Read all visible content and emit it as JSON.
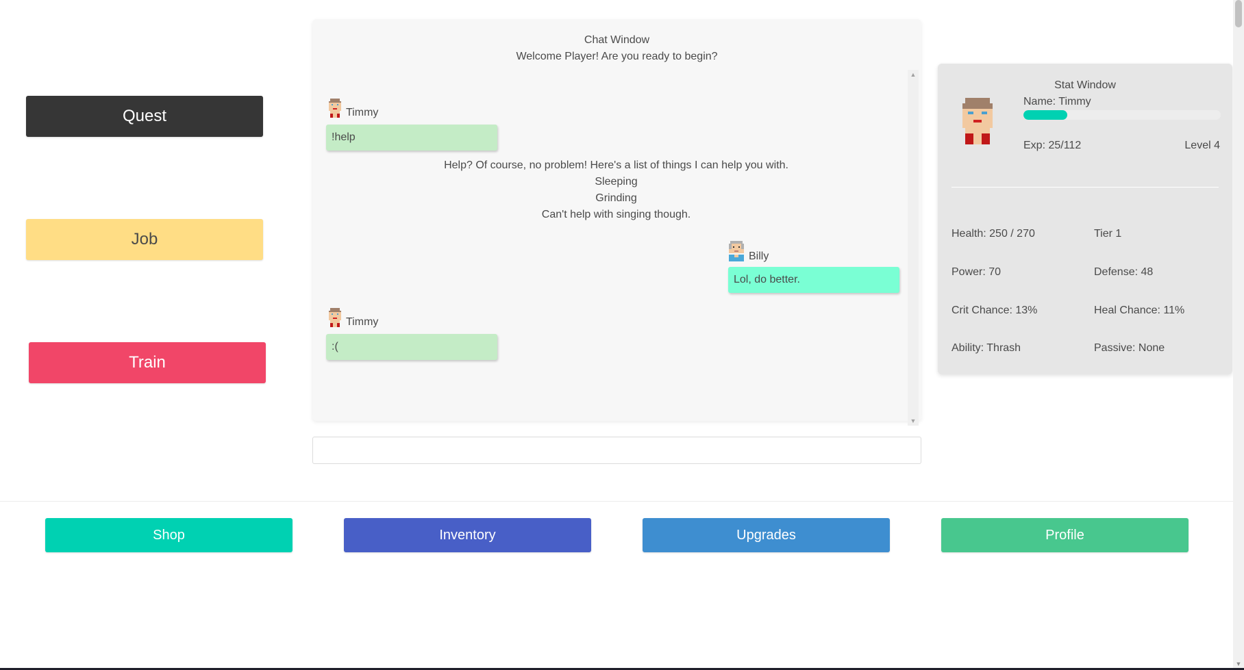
{
  "actions": {
    "quest": "Quest",
    "job": "Job",
    "train": "Train"
  },
  "chat": {
    "title": "Chat Window",
    "welcome": "Welcome Player! Are you ready to begin?",
    "messages": [
      {
        "user": "Timmy",
        "text": "!help",
        "color": "#c4ecc6"
      },
      {
        "bot_lines": [
          "Help? Of course, no problem! Here's a list of things I can help you with.",
          "Sleeping",
          "Grinding",
          "Can't help with singing though."
        ]
      },
      {
        "user": "Billy",
        "text": "Lol, do better.",
        "color": "#7affd4"
      },
      {
        "user": "Timmy",
        "text": ":(",
        "color": "#c4ecc6"
      }
    ],
    "input_value": ""
  },
  "stats": {
    "title": "Stat Window",
    "name": "Name: Timmy",
    "exp": "Exp: 25/112",
    "exp_fraction": 0.223,
    "level": "Level 4",
    "health": "Health: 250 / 270",
    "tier": "Tier 1",
    "power": "Power: 70",
    "defense": "Defense: 48",
    "crit": "Crit Chance: 13%",
    "heal": "Heal Chance: 11%",
    "ability": "Ability: Thrash",
    "passive": "Passive: None"
  },
  "nav": {
    "shop": "Shop",
    "inventory": "Inventory",
    "upgrades": "Upgrades",
    "profile": "Profile"
  },
  "colors": {
    "quest": "#363636",
    "job": "#ffdd85",
    "train": "#f14668",
    "shop": "#00d1b2",
    "inventory": "#485fc7",
    "upgrades": "#3e8ed0",
    "profile": "#48c78e",
    "exp_bar": "#00d1b2"
  }
}
